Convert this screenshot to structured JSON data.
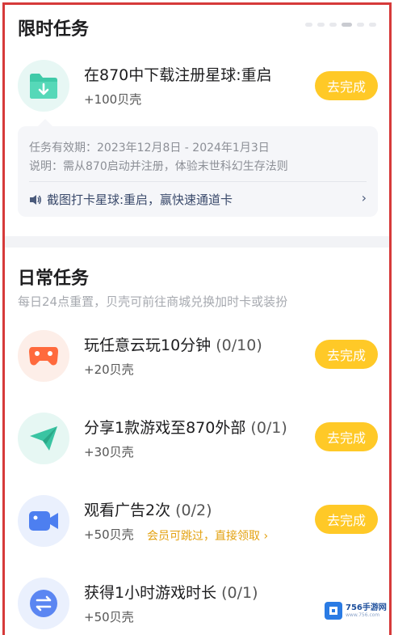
{
  "limited": {
    "title": "限时任务",
    "task": {
      "icon": "download-folder-icon",
      "title": "在870中下载注册星球:重启",
      "reward": "+100贝壳",
      "button": "去完成"
    },
    "info": {
      "validity": "任务有效期：2023年12月8日 - 2024年1月3日",
      "desc": "说明：需从870启动并注册，体验末世科幻生存法则",
      "link": "截图打卡星球:重启，赢快速通道卡",
      "link_icon": "speaker-icon",
      "arrow_icon": "chevron-right-icon"
    }
  },
  "daily": {
    "title": "日常任务",
    "subtitle": "每日24点重置，贝壳可前往商城兑换加时卡或装扮",
    "tasks": [
      {
        "icon": "gamepad-icon",
        "title": "玩任意云玩10分钟",
        "progress": "(0/10)",
        "reward": "+20贝壳",
        "button": "去完成"
      },
      {
        "icon": "paper-plane-icon",
        "title": "分享1款游戏至870外部",
        "progress": "(0/1)",
        "reward": "+30贝壳",
        "button": "去完成"
      },
      {
        "icon": "video-camera-icon",
        "title": "观看广告2次",
        "progress": "(0/2)",
        "reward": "+50贝壳",
        "vip_link": "会员可跳过，直接领取 ›",
        "button": "去完成"
      },
      {
        "icon": "exchange-icon",
        "title": "获得1小时游戏时长",
        "progress": "(0/1)",
        "reward": "+50贝壳"
      }
    ]
  },
  "watermark": {
    "brand": "756手游网",
    "url": "www.756.com"
  },
  "colors": {
    "button": "#ffc927",
    "vip": "#e3a10f",
    "frame": "#d63a3a"
  }
}
